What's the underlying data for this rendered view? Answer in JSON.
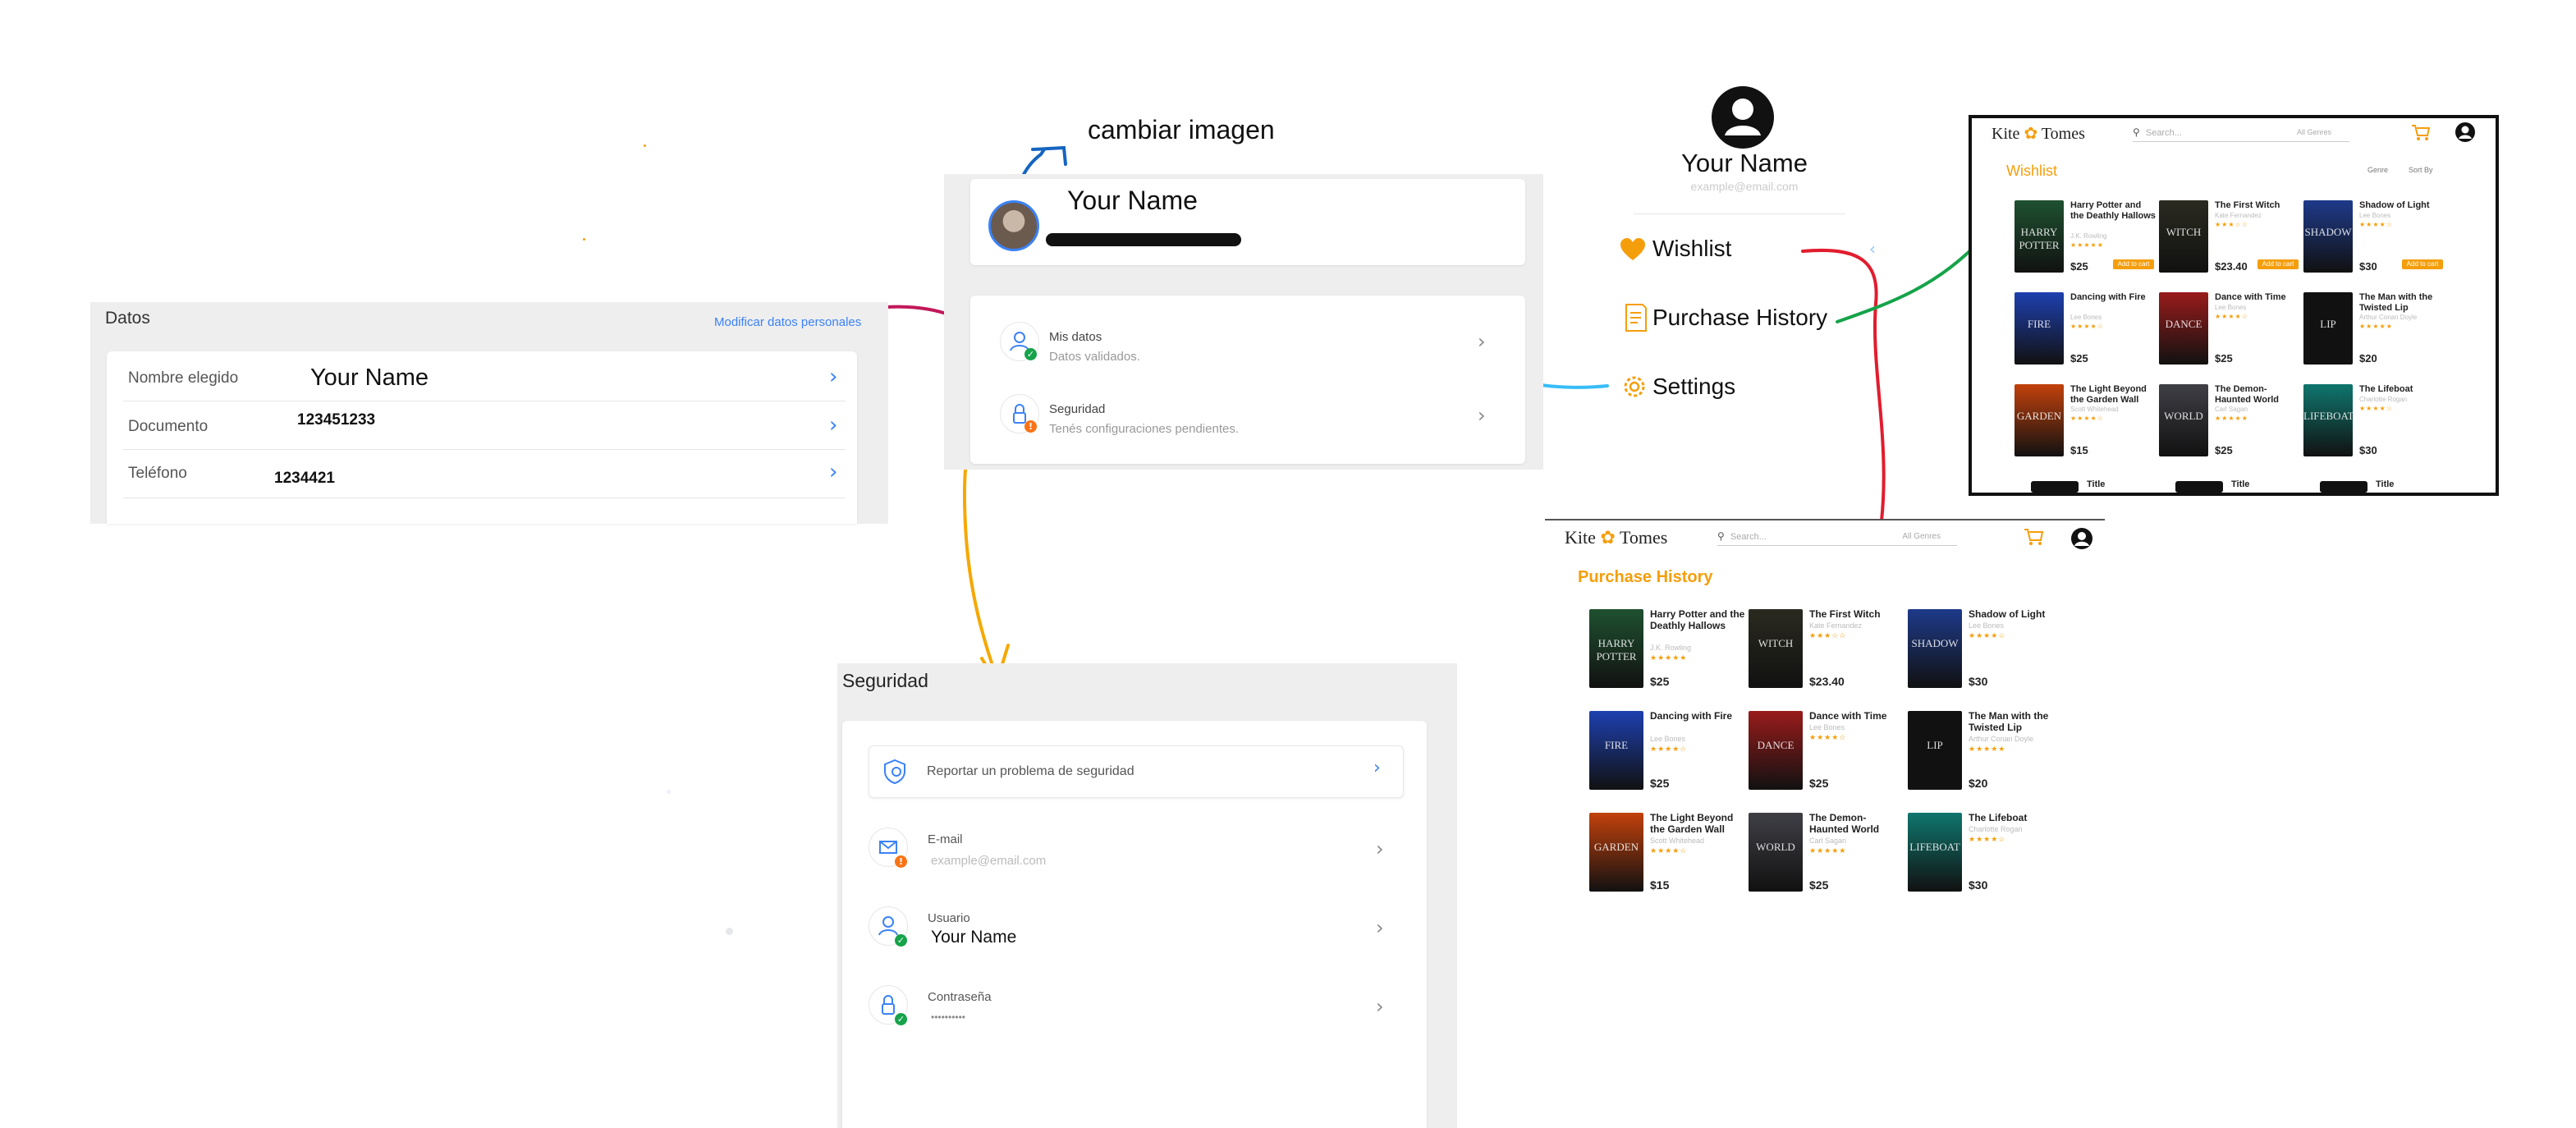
{
  "annotations": {
    "change_image": "cambiar imagen"
  },
  "profile_card": {
    "name": "Your Name",
    "mis_datos_title": "Mis datos",
    "mis_datos_sub": "Datos validados.",
    "seguridad_title": "Seguridad",
    "seguridad_sub": "Tenés configuraciones pendientes."
  },
  "datos": {
    "title": "Datos",
    "edit_link": "Modificar datos personales",
    "rows": [
      {
        "label": "Nombre elegido",
        "value": "Your Name"
      },
      {
        "label": "Documento",
        "value": "123451233"
      },
      {
        "label": "Teléfono",
        "value": "1234421"
      }
    ]
  },
  "seguridad": {
    "title": "Seguridad",
    "report": "Reportar un problema de seguridad",
    "rows": [
      {
        "label": "E-mail",
        "value": "example@email.com",
        "status": "warning"
      },
      {
        "label": "Usuario",
        "value": "Your Name",
        "status": "ok"
      },
      {
        "label": "Contraseña",
        "value": "••••••••••",
        "status": "ok"
      }
    ]
  },
  "menu": {
    "name": "Your Name",
    "email": "example@email.com",
    "items": [
      {
        "label": "Wishlist",
        "icon": "heart-icon"
      },
      {
        "label": "Purchase History",
        "icon": "receipt-icon"
      },
      {
        "label": "Settings",
        "icon": "gear-icon"
      }
    ]
  },
  "wishlist": {
    "logo_left": "Kite",
    "logo_right": "Tomes",
    "search_placeholder": "Search...",
    "genre_select": "All Genres",
    "title": "Wishlist",
    "filter_genre": "Genre",
    "filter_sort": "Sort By",
    "add_to_cart": "Add to cart",
    "cut_off_titles": [
      "Title",
      "Title",
      "Title"
    ],
    "books": [
      {
        "title": "Harry Potter and the Deathly Hallows",
        "author": "J.K. Rowling",
        "stars": "★★★★★",
        "price": "$25",
        "cover": "HARRY POTTER",
        "color": "#1f5130"
      },
      {
        "title": "The First Witch",
        "author": "Kate Fernandez",
        "stars": "★★★☆☆",
        "price": "$23.40",
        "cover": "WITCH",
        "color": "#2a2a20"
      },
      {
        "title": "Shadow of Light",
        "author": "Lee Bones",
        "stars": "★★★★☆",
        "price": "$30",
        "cover": "SHADOW",
        "color": "#1e3a8a"
      },
      {
        "title": "Dancing with Fire",
        "author": "Lee Bones",
        "stars": "★★★★☆",
        "price": "$25",
        "cover": "FIRE",
        "color": "#1e40af"
      },
      {
        "title": "Dance with Time",
        "author": "Lee Bones",
        "stars": "★★★★☆",
        "price": "$25",
        "cover": "DANCE",
        "color": "#991b1b"
      },
      {
        "title": "The Man with the Twisted Lip",
        "author": "Arthur Conan Doyle",
        "stars": "★★★★★",
        "price": "$20",
        "cover": "LIP",
        "color": "#111111"
      },
      {
        "title": "The Light Beyond the Garden Wall",
        "author": "Scott Whitehead",
        "stars": "★★★★☆",
        "price": "$15",
        "cover": "GARDEN",
        "color": "#c2410c"
      },
      {
        "title": "The Demon-Haunted World",
        "author": "Carl Sagan",
        "stars": "★★★★★",
        "price": "$25",
        "cover": "WORLD",
        "color": "#3f3f46"
      },
      {
        "title": "The Lifeboat",
        "author": "Charlotte Rogan",
        "stars": "★★★★☆",
        "price": "$30",
        "cover": "LIFEBOAT",
        "color": "#0f766e"
      }
    ]
  },
  "purchase": {
    "logo_left": "Kite",
    "logo_right": "Tomes",
    "search_placeholder": "Search...",
    "genre_select": "All Genres",
    "title": "Purchase History",
    "books": [
      {
        "title": "Harry Potter and the Deathly Hallows",
        "author": "J.K. Rowling",
        "stars": "★★★★★",
        "price": "$25",
        "cover": "HARRY POTTER",
        "color": "#1f5130"
      },
      {
        "title": "The First Witch",
        "author": "Kate Fernandez",
        "stars": "★★★☆☆",
        "price": "$23.40",
        "cover": "WITCH",
        "color": "#2a2a20"
      },
      {
        "title": "Shadow of Light",
        "author": "Lee Bones",
        "stars": "★★★★☆",
        "price": "$30",
        "cover": "SHADOW",
        "color": "#1e3a8a"
      },
      {
        "title": "Dancing with Fire",
        "author": "Lee Bones",
        "stars": "★★★★☆",
        "price": "$25",
        "cover": "FIRE",
        "color": "#1e40af"
      },
      {
        "title": "Dance with Time",
        "author": "Lee Bones",
        "stars": "★★★★☆",
        "price": "$25",
        "cover": "DANCE",
        "color": "#991b1b"
      },
      {
        "title": "The Man with the Twisted Lip",
        "author": "Arthur Conan Doyle",
        "stars": "★★★★★",
        "price": "$20",
        "cover": "LIP",
        "color": "#111111"
      },
      {
        "title": "The Light Beyond the Garden Wall",
        "author": "Scott Whitehead",
        "stars": "★★★★☆",
        "price": "$15",
        "cover": "GARDEN",
        "color": "#c2410c"
      },
      {
        "title": "The Demon-Haunted World",
        "author": "Carl Sagan",
        "stars": "★★★★★",
        "price": "$25",
        "cover": "WORLD",
        "color": "#3f3f46"
      },
      {
        "title": "The Lifeboat",
        "author": "Charlotte Rogan",
        "stars": "★★★★☆",
        "price": "$30",
        "cover": "LIFEBOAT",
        "color": "#0f766e"
      }
    ]
  },
  "colors": {
    "accent_orange": "#f59e0b",
    "link_blue": "#3b82f6",
    "arrow_blue": "#1565c0",
    "arrow_magenta": "#c2185b",
    "arrow_cyan": "#38bdf8",
    "arrow_red": "#e11d2e",
    "arrow_green": "#16a34a",
    "arrow_yellow": "#f5a800"
  }
}
